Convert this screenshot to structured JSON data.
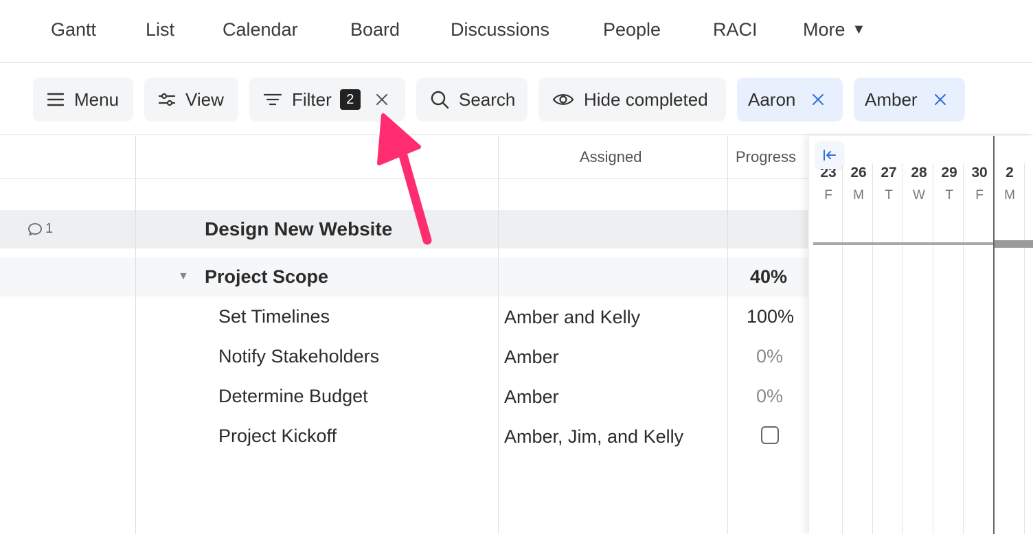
{
  "nav": {
    "tabs": [
      "Gantt",
      "List",
      "Calendar",
      "Board",
      "Discussions",
      "People",
      "RACI"
    ],
    "more_label": "More"
  },
  "toolbar": {
    "menu_label": "Menu",
    "view_label": "View",
    "filter_label": "Filter",
    "filter_count": "2",
    "search_label": "Search",
    "hide_completed_label": "Hide completed",
    "chips": [
      "Aaron",
      "Amber"
    ]
  },
  "columns": {
    "assigned": "Assigned",
    "progress": "Progress"
  },
  "rows": {
    "project": {
      "comment_count": "1",
      "name": "Design New Website"
    },
    "group": {
      "name": "Project Scope",
      "progress": "40%"
    },
    "tasks": [
      {
        "name": "Set Timelines",
        "assigned": "Amber and Kelly",
        "progress": "100%"
      },
      {
        "name": "Notify Stakeholders",
        "assigned": "Amber",
        "progress": "0%"
      },
      {
        "name": "Determine Budget",
        "assigned": "Amber",
        "progress": "0%"
      },
      {
        "name": "Project Kickoff",
        "assigned": "Amber, Jim, and Kelly",
        "progress": ""
      }
    ]
  },
  "gantt": {
    "days": [
      {
        "num": "23",
        "dow": "F"
      },
      {
        "num": "26",
        "dow": "M"
      },
      {
        "num": "27",
        "dow": "T"
      },
      {
        "num": "28",
        "dow": "W"
      },
      {
        "num": "29",
        "dow": "T"
      },
      {
        "num": "30",
        "dow": "F"
      },
      {
        "num": "2",
        "dow": "M"
      }
    ]
  },
  "colors": {
    "annotation_arrow": "#ff2d6f",
    "chip_bg": "#e9f0fd",
    "chip_x": "#2f6fdc"
  }
}
